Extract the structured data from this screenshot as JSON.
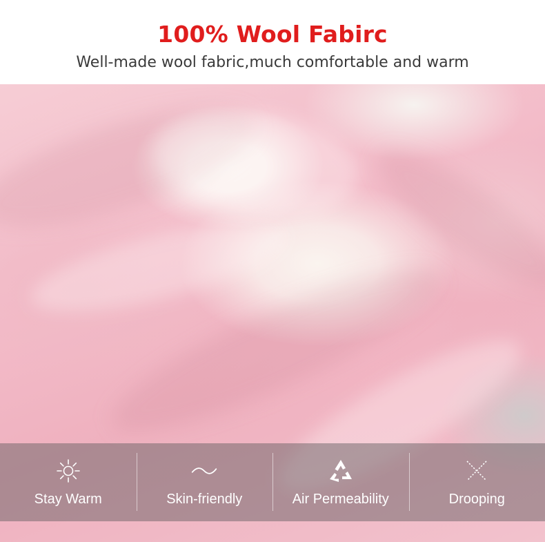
{
  "header": {
    "title": "100% Wool Fabirc",
    "subtitle": "Well-made wool fabric,much comfortable and warm"
  },
  "colors": {
    "title": "#e01d1d",
    "subtitle": "#3a3a3a",
    "bar_overlay": "#5c585a",
    "fabric_pink": "#f2bcc8",
    "fabric_cream": "#faf4ef",
    "fabric_grey": "#cfcacb"
  },
  "features": [
    {
      "label": "Stay Warm",
      "icon": "sun-icon"
    },
    {
      "label": "Skin-friendly",
      "icon": "wave-icon"
    },
    {
      "label": "Air Permeability",
      "icon": "recycle-icon"
    },
    {
      "label": "Drooping",
      "icon": "cross-icon"
    }
  ]
}
